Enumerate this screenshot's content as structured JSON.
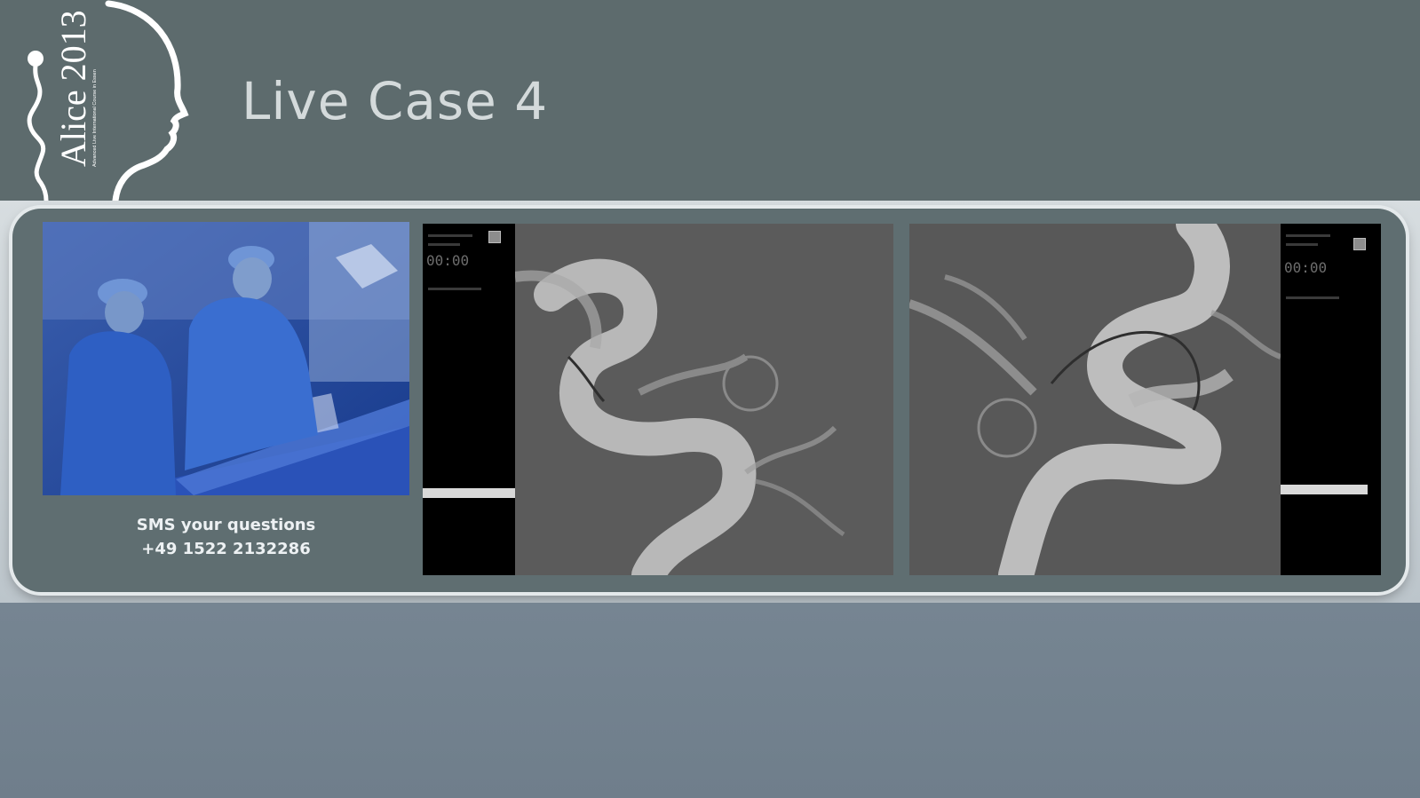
{
  "header": {
    "title": "Live Case 4",
    "logo_text": "Alice 2013",
    "logo_subtitle": "Advanced Live International Course in Essen"
  },
  "sms": {
    "line1": "SMS your questions",
    "line2": "+49 1522 2132286"
  },
  "monitors": [
    {
      "clock": "00:00"
    },
    {
      "clock": "00:00"
    }
  ],
  "colors": {
    "header_bg": "#5d6b6d",
    "panel_bg": "#5f6e71",
    "page_bg": "#738390",
    "title_text": "#d4dadb"
  }
}
